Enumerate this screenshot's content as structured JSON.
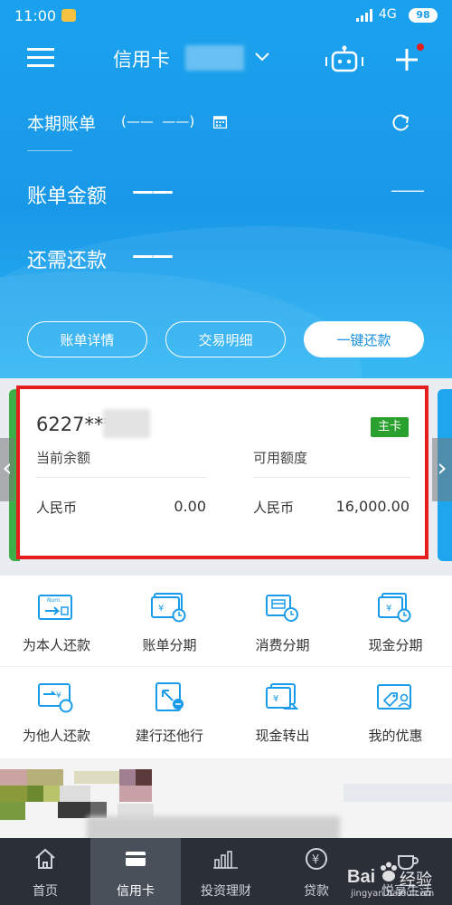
{
  "status_bar": {
    "time": "11:00",
    "network": "4G",
    "battery": "98"
  },
  "header": {
    "title": "信用卡"
  },
  "bill": {
    "period_label": "本期账单",
    "period_value": "(——  ——)",
    "amount_label": "账单金额",
    "amount_value": "——",
    "amount_right": "——",
    "remaining_label": "还需还款",
    "remaining_value": "——"
  },
  "actions": {
    "details": "账单详情",
    "transactions": "交易明细",
    "repay": "一键还款"
  },
  "card": {
    "number": "6227***",
    "badge": "主卡",
    "balance_label": "当前余额",
    "limit_label": "可用额度",
    "balance_currency": "人民币",
    "balance_value": "0.00",
    "limit_currency": "人民币",
    "limit_value": "16,000.00",
    "prev_arrow": "‹",
    "next_arrow": "›"
  },
  "services": [
    {
      "label": "为本人还款",
      "icon": "self-repay-icon"
    },
    {
      "label": "账单分期",
      "icon": "bill-installment-icon"
    },
    {
      "label": "消费分期",
      "icon": "consumption-installment-icon"
    },
    {
      "label": "现金分期",
      "icon": "cash-installment-icon"
    },
    {
      "label": "为他人还款",
      "icon": "others-repay-icon"
    },
    {
      "label": "建行还他行",
      "icon": "interbank-repay-icon"
    },
    {
      "label": "现金转出",
      "icon": "cash-transfer-icon"
    },
    {
      "label": "我的优惠",
      "icon": "my-offers-icon"
    }
  ],
  "num_tag": "Num.",
  "tabs": [
    {
      "label": "首页",
      "icon": "home-icon"
    },
    {
      "label": "信用卡",
      "icon": "credit-card-icon"
    },
    {
      "label": "投资理财",
      "icon": "investment-icon"
    },
    {
      "label": "贷款",
      "icon": "loan-icon"
    },
    {
      "label": "悦享生活",
      "icon": "lifestyle-icon"
    }
  ],
  "watermark": {
    "logo": "Bai",
    "text": "经验",
    "url": "jingyan.baidu.com"
  },
  "colors": {
    "primary": "#1a9bea",
    "highlight_border": "#e51d1d",
    "badge": "#2aa12f",
    "tabbar": "#2b2f38"
  }
}
